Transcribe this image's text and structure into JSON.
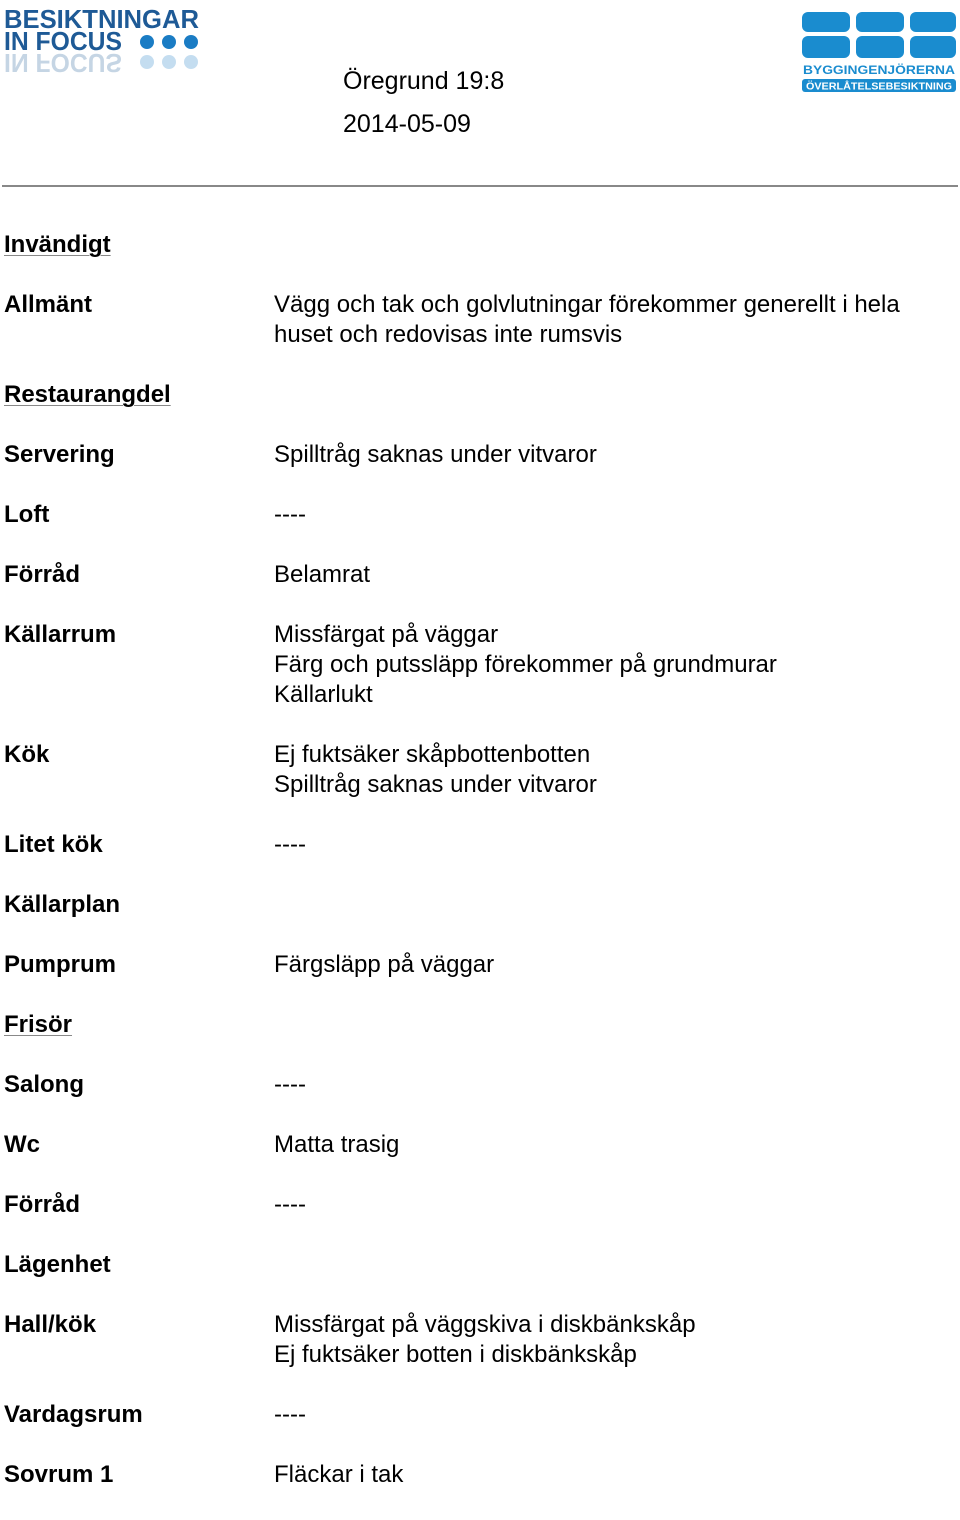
{
  "header": {
    "logo_left": "BESIKTNINGAR IN FOCUS",
    "logo_right": {
      "line1": "BYGGINGENJÖRERNA",
      "line2": "ÖVERLÅTELSEBESIKTNING"
    },
    "title": "Öregrund 19:8",
    "date": "2014-05-09",
    "brand_color": "#1a8ccf"
  },
  "rows": [
    {
      "label": "Invändigt",
      "heading": true,
      "values": []
    },
    {
      "label": "Allmänt",
      "values": [
        "Vägg och tak och golvlutningar förekommer generellt i hela",
        "huset och redovisas inte rumsvis"
      ]
    },
    {
      "label": "Restaurangdel",
      "heading": true,
      "values": []
    },
    {
      "label": "Servering",
      "values": [
        "Spilltråg saknas under vitvaror"
      ]
    },
    {
      "label": "Loft",
      "values": [
        "----"
      ]
    },
    {
      "label": "Förråd",
      "values": [
        "Belamrat"
      ]
    },
    {
      "label": "Källarrum",
      "values": [
        "Missfärgat på väggar",
        "Färg och putssläpp förekommer på grundmurar",
        "Källarlukt"
      ]
    },
    {
      "label": "Kök",
      "values": [
        "Ej fuktsäker skåpbottenbotten",
        "Spilltråg saknas under vitvaror"
      ]
    },
    {
      "label": "Litet kök",
      "values": [
        "----"
      ]
    },
    {
      "label": "Källarplan",
      "values": []
    },
    {
      "label": "Pumprum",
      "values": [
        "Färgsläpp på väggar"
      ]
    },
    {
      "label": "Frisör",
      "heading": true,
      "values": []
    },
    {
      "label": "Salong",
      "values": [
        "----"
      ]
    },
    {
      "label": "Wc",
      "values": [
        "Matta trasig"
      ]
    },
    {
      "label": "Förråd",
      "values": [
        "----"
      ]
    },
    {
      "label": "Lägenhet",
      "values": [],
      "gap": true
    },
    {
      "label": "Hall/kök",
      "values": [
        "Missfärgat på väggskiva i diskbänkskåp",
        "Ej fuktsäker botten i diskbänkskåp"
      ]
    },
    {
      "label": "Vardagsrum",
      "values": [
        "----"
      ]
    },
    {
      "label": "Sovrum 1",
      "values": [
        "Fläckar i tak"
      ]
    }
  ]
}
